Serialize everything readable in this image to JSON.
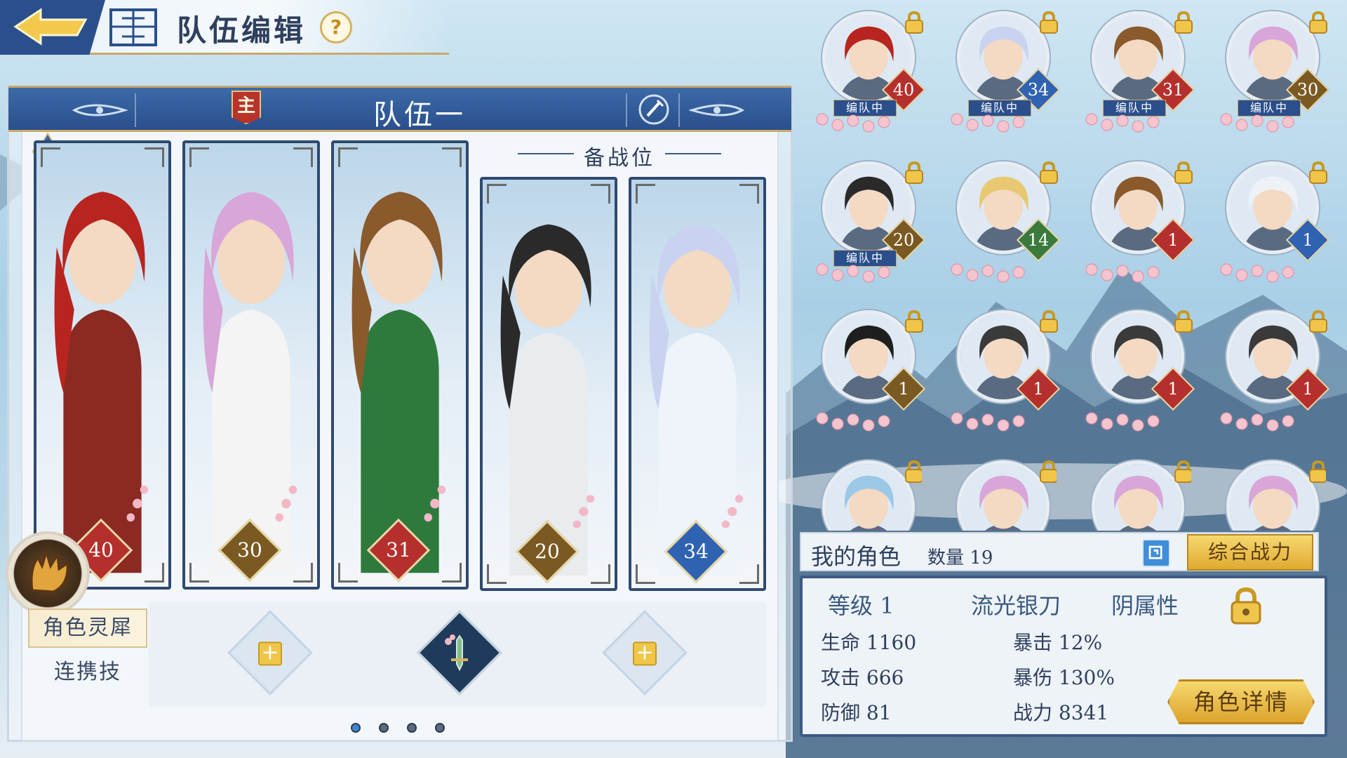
{
  "header": {
    "title": "队伍编辑",
    "help_label": "?"
  },
  "team": {
    "leader_label": "主",
    "name": "队伍一",
    "bench_label": "备战位",
    "cards": [
      {
        "level": "40",
        "element": "red",
        "hair": "#b8241f",
        "outfit": "#8a2a22"
      },
      {
        "level": "30",
        "element": "gold",
        "hair": "#d8a6d8",
        "outfit": "#f4f4f4"
      },
      {
        "level": "31",
        "element": "red",
        "hair": "#8a5a2c",
        "outfit": "#2e7a3c"
      },
      {
        "level": "20",
        "element": "gold",
        "hair": "#2a2a2a",
        "outfit": "#e8ecef"
      },
      {
        "level": "34",
        "element": "blue",
        "hair": "#c9d3ef",
        "outfit": "#eef4fa"
      }
    ],
    "tabs": {
      "spirit": "角色灵犀",
      "combo": "连携技"
    },
    "page_dots": 4,
    "active_page": 0
  },
  "roster": {
    "in_team_label": "编队中",
    "items": [
      {
        "level": "40",
        "element": "red",
        "in_team": true,
        "hair": "#b8241f"
      },
      {
        "level": "34",
        "element": "blue",
        "in_team": true,
        "hair": "#c9d3ef"
      },
      {
        "level": "31",
        "element": "red",
        "in_team": true,
        "hair": "#8a5a2c"
      },
      {
        "level": "30",
        "element": "gold",
        "in_team": true,
        "hair": "#d8a6d8"
      },
      {
        "level": "20",
        "element": "gold",
        "in_team": true,
        "hair": "#2a2a2a"
      },
      {
        "level": "14",
        "element": "green",
        "in_team": false,
        "hair": "#e8c870"
      },
      {
        "level": "1",
        "element": "red",
        "in_team": false,
        "hair": "#8a5a2c"
      },
      {
        "level": "1",
        "element": "blue",
        "in_team": false,
        "hair": "#eef2f6"
      },
      {
        "level": "1",
        "element": "gold",
        "in_team": false,
        "hair": "#1e1e1e"
      },
      {
        "level": "1",
        "element": "red",
        "in_team": false,
        "hair": "#3a3a3a"
      },
      {
        "level": "1",
        "element": "red",
        "in_team": false,
        "hair": "#3a3a3a"
      },
      {
        "level": "1",
        "element": "red",
        "in_team": false,
        "hair": "#3a3a3a"
      },
      {
        "level": "",
        "element": "none",
        "in_team": false,
        "hair": "#9cc8e8"
      },
      {
        "level": "",
        "element": "none",
        "in_team": false,
        "hair": "#d8a6d8"
      },
      {
        "level": "",
        "element": "none",
        "in_team": false,
        "hair": "#d8a6d8"
      },
      {
        "level": "",
        "element": "none",
        "in_team": false,
        "hair": "#d8a6d8"
      }
    ]
  },
  "info": {
    "my_chars": "我的角色",
    "count_label": "数量",
    "count": "19",
    "power_sort": "综合战力",
    "level_label": "等级",
    "level": "1",
    "name": "流光银刀",
    "attribute": "阴属性",
    "hp_label": "生命",
    "hp": "1160",
    "atk_label": "攻击",
    "atk": "666",
    "def_label": "防御",
    "def": "81",
    "crit_label": "暴击",
    "crit": "12%",
    "critdmg_label": "暴伤",
    "critdmg": "130%",
    "power_label": "战力",
    "power": "8341",
    "detail_button": "角色详情"
  },
  "colors": {
    "red": "#b5302d",
    "gold": "#7a5a22",
    "blue": "#2f62b0",
    "green": "#3a7a3c",
    "frame": "#2f4a70",
    "accent_gold": "#e0aa30"
  }
}
